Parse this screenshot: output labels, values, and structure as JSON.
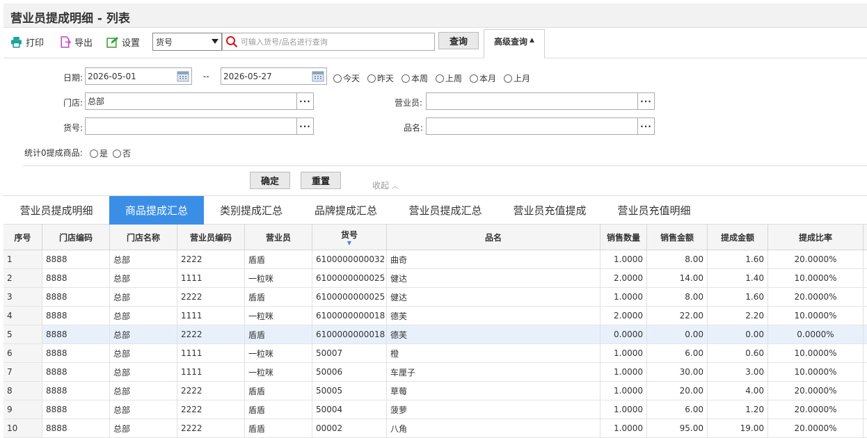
{
  "title": "营业员提成明细 - 列表",
  "toolbar": {
    "print": "打印",
    "export": "导出",
    "settings": "设置",
    "search_field": "货号",
    "search_placeholder": "可输入货号/品名进行查询",
    "query": "查询",
    "advanced": "高级查询"
  },
  "filters": {
    "date_label": "日期:",
    "date_from": "2026-05-01",
    "date_sep": "--",
    "date_to": "2026-05-27",
    "quick_dates": [
      "今天",
      "昨天",
      "本周",
      "上周",
      "本月",
      "上月"
    ],
    "store_label": "门店:",
    "store_value": "总部",
    "clerk_label": "营业员:",
    "clerk_value": "",
    "code_label": "货号:",
    "code_value": "",
    "name_label": "品名:",
    "name_value": "",
    "zero_label": "统计0提成商品:",
    "zero_yes": "是",
    "zero_no": "否",
    "confirm": "确定",
    "reset": "重置",
    "collapse": "收起"
  },
  "tabs": [
    "营业员提成明细",
    "商品提成汇总",
    "类别提成汇总",
    "品牌提成汇总",
    "营业员提成汇总",
    "营业员充值提成",
    "营业员充值明细"
  ],
  "active_tab": 1,
  "columns": [
    "序号",
    "门店编码",
    "门店名称",
    "营业员编码",
    "营业员",
    "货号",
    "品名",
    "销售数量",
    "销售金额",
    "提成金额",
    "提成比率"
  ],
  "rows": [
    [
      "1",
      "8888",
      "总部",
      "2222",
      "盾盾",
      "6100000000032",
      "曲奇",
      "1.0000",
      "8.00",
      "1.60",
      "20.0000%"
    ],
    [
      "2",
      "8888",
      "总部",
      "1111",
      "一粒咪",
      "6100000000025",
      "健达",
      "2.0000",
      "14.00",
      "1.40",
      "10.0000%"
    ],
    [
      "3",
      "8888",
      "总部",
      "2222",
      "盾盾",
      "6100000000025",
      "健达",
      "1.0000",
      "8.00",
      "1.60",
      "20.0000%"
    ],
    [
      "4",
      "8888",
      "总部",
      "1111",
      "一粒咪",
      "6100000000018",
      "德芙",
      "2.0000",
      "22.00",
      "2.20",
      "10.0000%"
    ],
    [
      "5",
      "8888",
      "总部",
      "2222",
      "盾盾",
      "6100000000018",
      "德芙",
      "0.0000",
      "0.00",
      "0.00",
      "0.0000%"
    ],
    [
      "6",
      "8888",
      "总部",
      "1111",
      "一粒咪",
      "50007",
      "橙",
      "1.0000",
      "6.00",
      "0.60",
      "10.0000%"
    ],
    [
      "7",
      "8888",
      "总部",
      "1111",
      "一粒咪",
      "50006",
      "车厘子",
      "1.0000",
      "30.00",
      "3.00",
      "10.0000%"
    ],
    [
      "8",
      "8888",
      "总部",
      "2222",
      "盾盾",
      "50005",
      "草莓",
      "1.0000",
      "20.00",
      "4.00",
      "20.0000%"
    ],
    [
      "9",
      "8888",
      "总部",
      "2222",
      "盾盾",
      "50004",
      "菠萝",
      "1.0000",
      "6.00",
      "1.20",
      "20.0000%"
    ],
    [
      "10",
      "8888",
      "总部",
      "2222",
      "盾盾",
      "00002",
      "八角",
      "1.0000",
      "95.00",
      "19.00",
      "20.0000%"
    ]
  ],
  "colors": {
    "accent": "#3a8ee6",
    "highlight_row": "#e8f1fb"
  }
}
